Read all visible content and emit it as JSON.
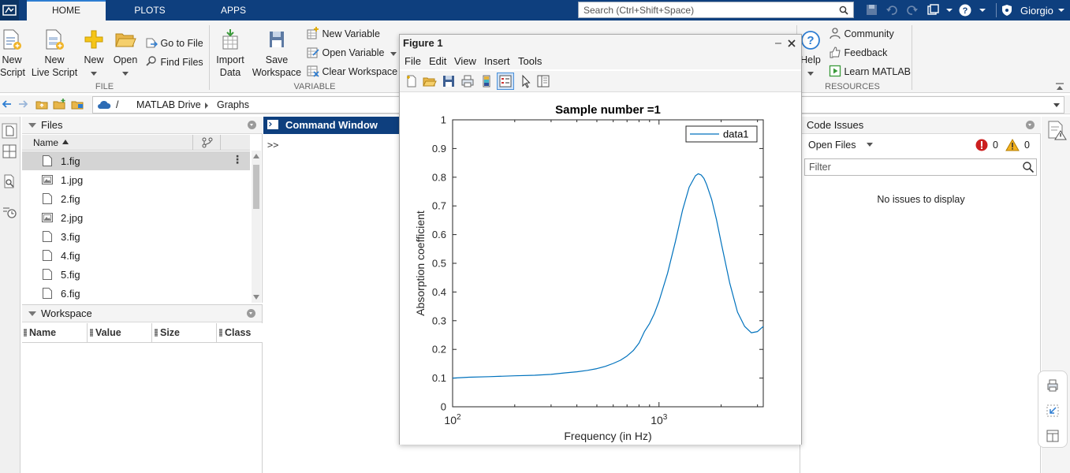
{
  "tabs": [
    {
      "label": "HOME"
    },
    {
      "label": "PLOTS"
    },
    {
      "label": "APPS"
    }
  ],
  "search": {
    "placeholder": "Search (Ctrl+Shift+Space)"
  },
  "user": {
    "name": "Giorgio"
  },
  "ribbon": {
    "file": {
      "new_script": [
        "New",
        "Script"
      ],
      "new_live_script": [
        "New",
        "Live Script"
      ],
      "new": "New",
      "open": "Open",
      "go_to_file": "Go to File",
      "find_files": "Find Files",
      "group_label": "FILE"
    },
    "variable": {
      "import_data": [
        "Import",
        "Data"
      ],
      "save_workspace": [
        "Save",
        "Workspace"
      ],
      "new_variable": "New Variable",
      "open_variable": "Open Variable",
      "clear_workspace": "Clear Workspace",
      "group_label": "VARIABLE"
    },
    "resources": {
      "help": "Help",
      "community": "Community",
      "feedback": "Feedback",
      "learn_matlab": "Learn MATLAB",
      "group_label": "RESOURCES"
    }
  },
  "address": {
    "separator": "/",
    "folder1": "MATLAB Drive",
    "folder2": "Graphs"
  },
  "files": {
    "title": "Files",
    "column_name": "Name",
    "items": [
      {
        "name": "1.fig",
        "kind": "fig"
      },
      {
        "name": "1.jpg",
        "kind": "img"
      },
      {
        "name": "2.fig",
        "kind": "fig"
      },
      {
        "name": "2.jpg",
        "kind": "img"
      },
      {
        "name": "3.fig",
        "kind": "fig"
      },
      {
        "name": "4.fig",
        "kind": "fig"
      },
      {
        "name": "5.fig",
        "kind": "fig"
      },
      {
        "name": "6.fig",
        "kind": "fig"
      }
    ]
  },
  "workspace": {
    "title": "Workspace",
    "columns": [
      "Name",
      "Value",
      "Size",
      "Class"
    ]
  },
  "command_window": {
    "title": "Command Window",
    "prompt": ">>"
  },
  "code_issues": {
    "title": "Code Issues",
    "open_files": "Open Files",
    "errors": "0",
    "warnings": "0",
    "filter_placeholder": "Filter",
    "empty_message": "No issues to display"
  },
  "figure": {
    "title": "Figure 1",
    "menu": [
      "File",
      "Edit",
      "View",
      "Insert",
      "Tools"
    ]
  },
  "colors": {
    "titlebar": "#0e3f7e",
    "series": "#0072bd",
    "error": "#cc1f1f",
    "warning": "#e8a317"
  },
  "chart_data": {
    "type": "line",
    "title": "Sample number =1",
    "xlabel": "Frequency (in Hz)",
    "ylabel": "Absorption coefficient",
    "xscale": "log",
    "xlim": [
      100,
      3200
    ],
    "ylim": [
      0,
      1
    ],
    "xticks": [
      {
        "base": "10",
        "exp": "2"
      },
      {
        "base": "10",
        "exp": "3"
      }
    ],
    "yticks": [
      "0",
      "0.1",
      "0.2",
      "0.3",
      "0.4",
      "0.5",
      "0.6",
      "0.7",
      "0.8",
      "0.9",
      "1"
    ],
    "legend": "top-right",
    "series": [
      {
        "name": "data1",
        "x": [
          100,
          120,
          150,
          200,
          250,
          300,
          350,
          400,
          450,
          500,
          550,
          600,
          650,
          700,
          750,
          800,
          850,
          900,
          950,
          1000,
          1100,
          1200,
          1300,
          1400,
          1500,
          1550,
          1600,
          1650,
          1700,
          1800,
          1900,
          2000,
          2200,
          2400,
          2600,
          2800,
          3000,
          3200
        ],
        "y": [
          0.1,
          0.103,
          0.105,
          0.108,
          0.11,
          0.113,
          0.118,
          0.122,
          0.127,
          0.133,
          0.141,
          0.151,
          0.162,
          0.177,
          0.196,
          0.222,
          0.262,
          0.29,
          0.325,
          0.368,
          0.465,
          0.575,
          0.685,
          0.765,
          0.805,
          0.812,
          0.808,
          0.796,
          0.775,
          0.722,
          0.652,
          0.572,
          0.432,
          0.33,
          0.28,
          0.258,
          0.262,
          0.28
        ]
      }
    ]
  }
}
